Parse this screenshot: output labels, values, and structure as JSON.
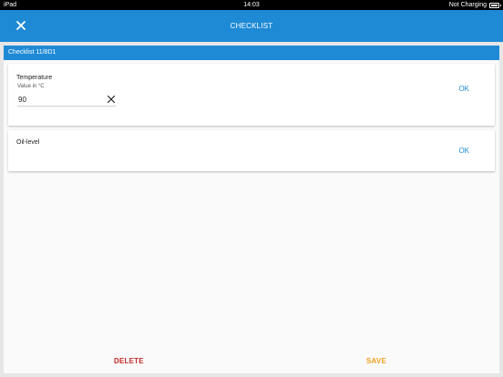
{
  "statusbar": {
    "device": "iPad",
    "time": "14:03",
    "charging": "Not Charging"
  },
  "appbar": {
    "title": "CHECKLIST",
    "close_icon": "close-icon"
  },
  "sheet": {
    "header": "Checklist 11/8D1"
  },
  "items": [
    {
      "label": "Temperature",
      "hint": "Value in °C",
      "value": "90",
      "action": "OK"
    },
    {
      "label": "Oil-level",
      "action": "OK"
    }
  ],
  "footer": {
    "delete_label": "DELETE",
    "save_label": "SAVE"
  },
  "colors": {
    "primary": "#1e8ad6",
    "delete": "#c62828",
    "save": "#f0a020"
  }
}
